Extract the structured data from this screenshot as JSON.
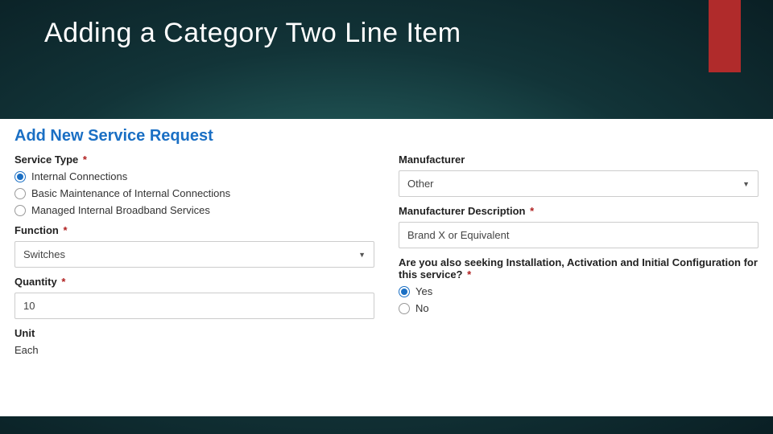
{
  "slide": {
    "title": "Adding a Category Two Line Item"
  },
  "form": {
    "title": "Add New Service Request",
    "left": {
      "service_type_label": "Service Type",
      "service_type_required": "*",
      "service_type_options": {
        "opt0": "Internal Connections",
        "opt1": "Basic Maintenance of Internal Connections",
        "opt2": "Managed Internal Broadband Services"
      },
      "function_label": "Function",
      "function_required": "*",
      "function_value": "Switches",
      "quantity_label": "Quantity",
      "quantity_required": "*",
      "quantity_value": "10",
      "unit_label": "Unit",
      "unit_value": "Each"
    },
    "right": {
      "manufacturer_label": "Manufacturer",
      "manufacturer_value": "Other",
      "manu_desc_label": "Manufacturer Description",
      "manu_desc_required": "*",
      "manu_desc_value": "Brand X or Equivalent",
      "install_q_label": "Are you also seeking Installation, Activation and Initial Configuration for this service?",
      "install_q_required": "*",
      "install_options": {
        "yes": "Yes",
        "no": "No"
      }
    }
  }
}
